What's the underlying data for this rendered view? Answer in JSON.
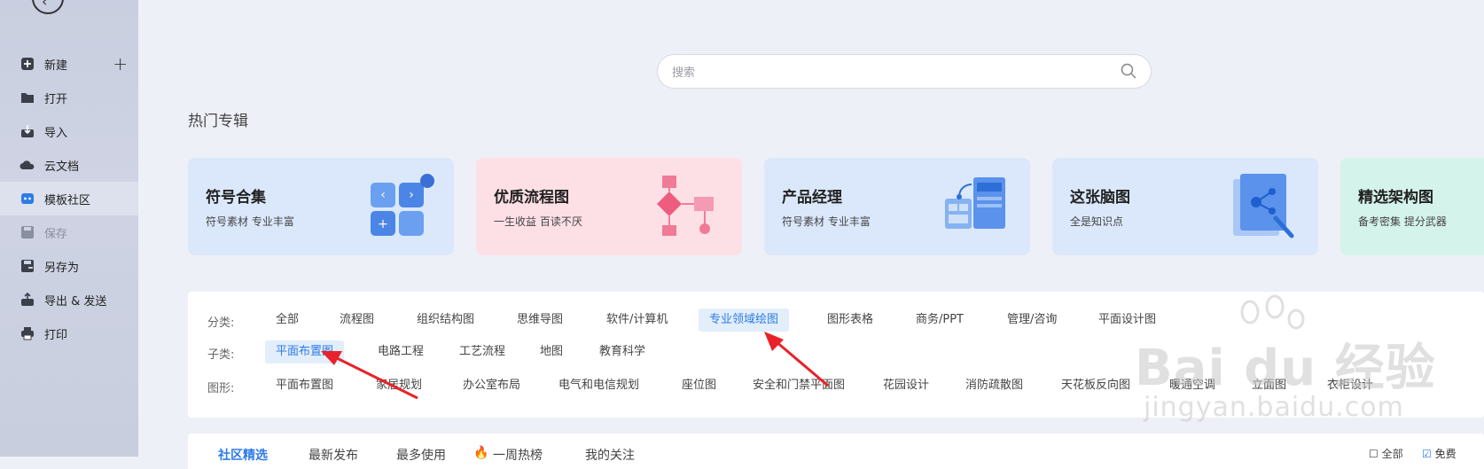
{
  "sidebar": {
    "items": [
      {
        "label": "新建",
        "icon": "plus-square-icon"
      },
      {
        "label": "打开",
        "icon": "folder-icon"
      },
      {
        "label": "导入",
        "icon": "import-icon"
      },
      {
        "label": "云文档",
        "icon": "cloud-icon"
      },
      {
        "label": "模板社区",
        "icon": "community-icon"
      },
      {
        "label": "保存",
        "icon": "save-icon"
      },
      {
        "label": "另存为",
        "icon": "save-as-icon"
      },
      {
        "label": "导出 & 发送",
        "icon": "export-icon"
      },
      {
        "label": "打印",
        "icon": "printer-icon"
      }
    ]
  },
  "search": {
    "placeholder": "搜索"
  },
  "featured": {
    "title": "热门专辑",
    "cards": [
      {
        "title": "符号合集",
        "subtitle": "符号素材 专业丰富",
        "color": "#dbe8fb"
      },
      {
        "title": "优质流程图",
        "subtitle": "一生收益 百读不厌",
        "color": "#fde0e6"
      },
      {
        "title": "产品经理",
        "subtitle": "符号素材 专业丰富",
        "color": "#dbe8fb"
      },
      {
        "title": "这张脑图",
        "subtitle": "全是知识点",
        "color": "#dbe8fb"
      },
      {
        "title": "精选架构图",
        "subtitle": "备考密集 提分武器",
        "color": "#d4f3ea"
      }
    ]
  },
  "filters": {
    "category_label": "分类:",
    "categories": [
      "全部",
      "流程图",
      "组织结构图",
      "思维导图",
      "软件/计算机",
      "专业领域绘图",
      "图形表格",
      "商务/PPT",
      "管理/咨询",
      "平面设计图"
    ],
    "subcategory_label": "子类:",
    "subcategories": [
      "平面布置图",
      "电路工程",
      "工艺流程",
      "地图",
      "教育科学"
    ],
    "shape_label": "图形:",
    "shapes": [
      "平面布置图",
      "家居规划",
      "办公室布局",
      "电气和电信规划",
      "座位图",
      "安全和门禁平面图",
      "花园设计",
      "消防疏散图",
      "天花板反向图",
      "暖通空调",
      "立面图",
      "衣柜设计"
    ]
  },
  "tabs": [
    "社区精选",
    "最新发布",
    "最多使用",
    "一周热榜",
    "我的关注"
  ],
  "tabs_right": [
    "全部",
    "免费"
  ],
  "watermark": {
    "brand": "Bai du 经验",
    "url": "jingyan.baidu.com"
  },
  "colors": {
    "accent": "#2d7ce6",
    "arrow": "#e8222a"
  }
}
